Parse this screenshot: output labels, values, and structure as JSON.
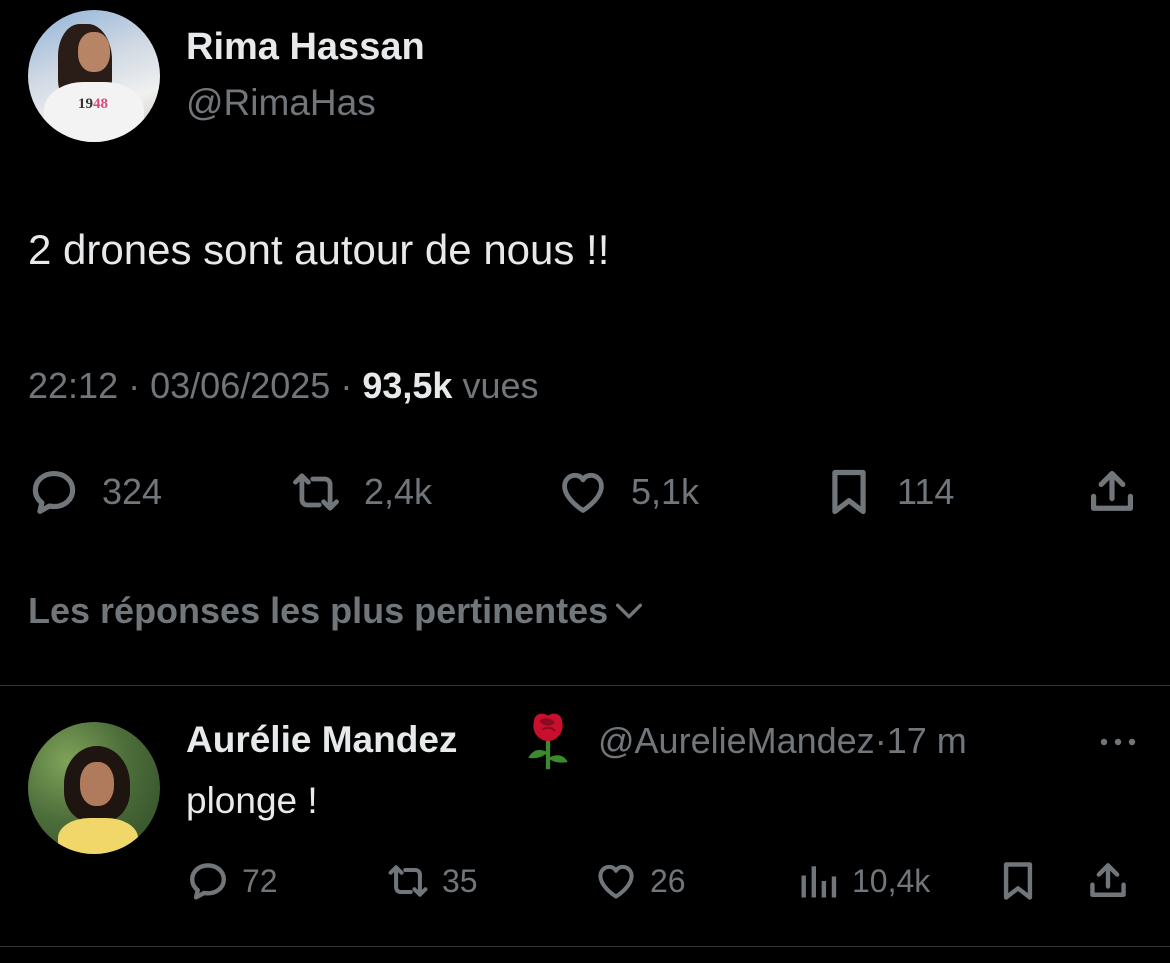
{
  "tweet": {
    "author_name": "Rima Hassan",
    "author_handle": "@RimaHas",
    "avatar_shirt_text_a": "19",
    "avatar_shirt_text_b": "48",
    "text": "2 drones sont autour de nous !!",
    "time": "22:12",
    "sep1": "·",
    "date": "03/06/2025",
    "sep2": "·",
    "views_count": "93,5k",
    "views_label": "vues",
    "stats": {
      "replies": "324",
      "reposts": "2,4k",
      "likes": "5,1k",
      "bookmarks": "114"
    }
  },
  "replies_sort": {
    "label": "Les réponses les plus pertinentes"
  },
  "reply": {
    "author_name": "Aurélie Mandez",
    "emoji": "rose-emoji",
    "author_handle": "@AurelieMandez",
    "sep": "·",
    "time_ago": "17 m",
    "text": "plonge !",
    "stats": {
      "replies": "72",
      "reposts": "35",
      "likes": "26",
      "views": "10,4k"
    }
  },
  "colors": {
    "background": "#000000",
    "primary_text": "#e7e9ea",
    "secondary_text": "#71767b",
    "divider": "#2f3336"
  }
}
